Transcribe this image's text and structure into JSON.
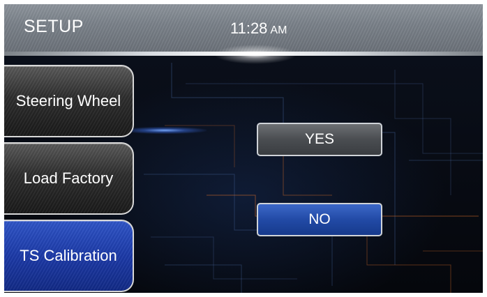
{
  "header": {
    "title": "SETUP",
    "time": "11:28",
    "ampm": "AM"
  },
  "sidebar": {
    "items": [
      {
        "label": "Steering Wheel",
        "active": false
      },
      {
        "label": "Load Factory",
        "active": false
      },
      {
        "label": "TS Calibration",
        "active": true
      }
    ]
  },
  "dialog": {
    "yes_label": "YES",
    "no_label": "NO"
  },
  "colors": {
    "accent_blue": "#1c3aa8",
    "header_gray": "#7a8189",
    "background": "#05070c"
  }
}
